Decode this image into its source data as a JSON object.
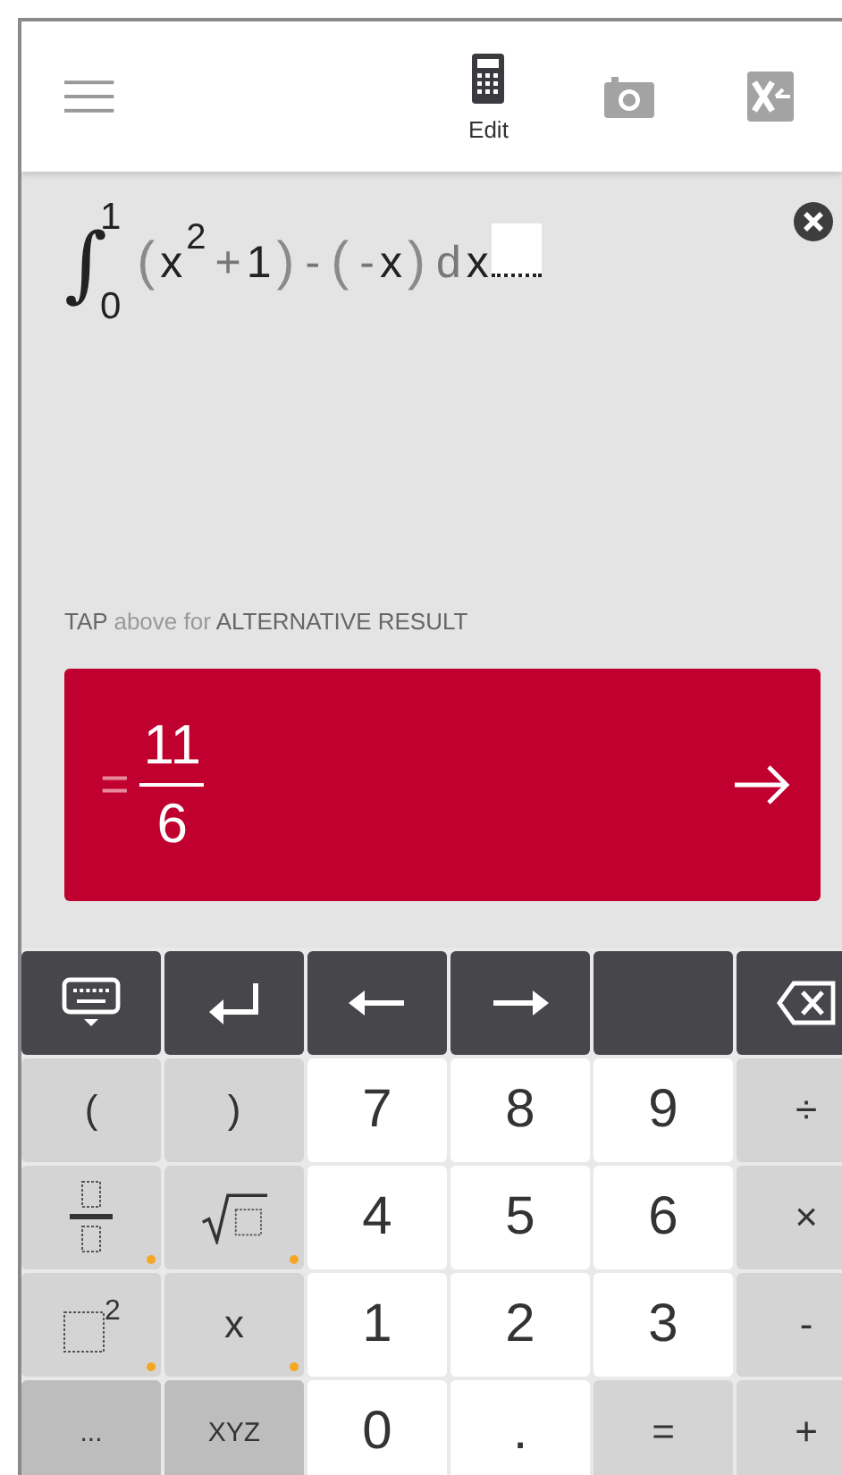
{
  "toolbar": {
    "tabs": [
      {
        "label": "Edit",
        "selected": true
      },
      {
        "selected": false
      },
      {
        "selected": false
      }
    ]
  },
  "expression": {
    "sign": "∫",
    "upper": "1",
    "lower": "0",
    "tokens": [
      {
        "text": "(",
        "kind": "paren"
      },
      {
        "text": "x",
        "kind": "main"
      },
      {
        "text": "2",
        "kind": "sup"
      },
      {
        "text": "+",
        "kind": "op"
      },
      {
        "text": "1",
        "kind": "main"
      },
      {
        "text": ")",
        "kind": "paren"
      },
      {
        "text": "-",
        "kind": "op"
      },
      {
        "text": "(",
        "kind": "paren"
      },
      {
        "text": "-",
        "kind": "op"
      },
      {
        "text": "x",
        "kind": "main"
      },
      {
        "text": ")",
        "kind": "paren"
      },
      {
        "text": "d",
        "kind": "op"
      },
      {
        "text": "x",
        "kind": "main"
      }
    ]
  },
  "hint": [
    {
      "text": "TAP",
      "strong": true
    },
    {
      "text": "above for",
      "strong": false
    },
    {
      "text": "ALTERNATIVE RESULT",
      "strong": true
    }
  ],
  "result": {
    "sign": "=",
    "numerator": "11",
    "denominator": "6"
  },
  "keys": [
    {
      "kind": "control",
      "options": false
    },
    {
      "kind": "control",
      "options": false
    },
    {
      "kind": "control",
      "options": false
    },
    {
      "kind": "control",
      "options": false
    },
    {
      "kind": "control",
      "options": false
    },
    {
      "kind": "control",
      "options": false
    },
    {
      "kind": "function",
      "label": "(",
      "options": false
    },
    {
      "kind": "function",
      "label": ")",
      "options": false
    },
    {
      "kind": "digit",
      "label": "7",
      "options": false
    },
    {
      "kind": "digit",
      "label": "8",
      "options": false
    },
    {
      "kind": "digit",
      "label": "9",
      "options": false
    },
    {
      "kind": "function",
      "label": "÷",
      "options": false
    },
    {
      "kind": "function",
      "options": true
    },
    {
      "kind": "function",
      "options": true
    },
    {
      "kind": "digit",
      "label": "4",
      "options": false
    },
    {
      "kind": "digit",
      "label": "5",
      "options": false
    },
    {
      "kind": "digit",
      "label": "6",
      "options": false
    },
    {
      "kind": "function",
      "label": "×",
      "options": false
    },
    {
      "kind": "function",
      "sup": "2",
      "options": true
    },
    {
      "kind": "function",
      "label": "x",
      "options": true
    },
    {
      "kind": "digit",
      "label": "1",
      "options": false
    },
    {
      "kind": "digit",
      "label": "2",
      "options": false
    },
    {
      "kind": "digit",
      "label": "3",
      "options": false
    },
    {
      "kind": "function",
      "label": "-",
      "options": false
    },
    {
      "kind": "more",
      "label": "...",
      "options": false
    },
    {
      "kind": "more",
      "label": "XYZ",
      "options": false
    },
    {
      "kind": "digit",
      "label": "0",
      "options": false
    },
    {
      "kind": "digit",
      "label": ".",
      "options": false
    },
    {
      "kind": "function",
      "label": "=",
      "options": false
    },
    {
      "kind": "function",
      "label": "+",
      "options": false
    }
  ]
}
